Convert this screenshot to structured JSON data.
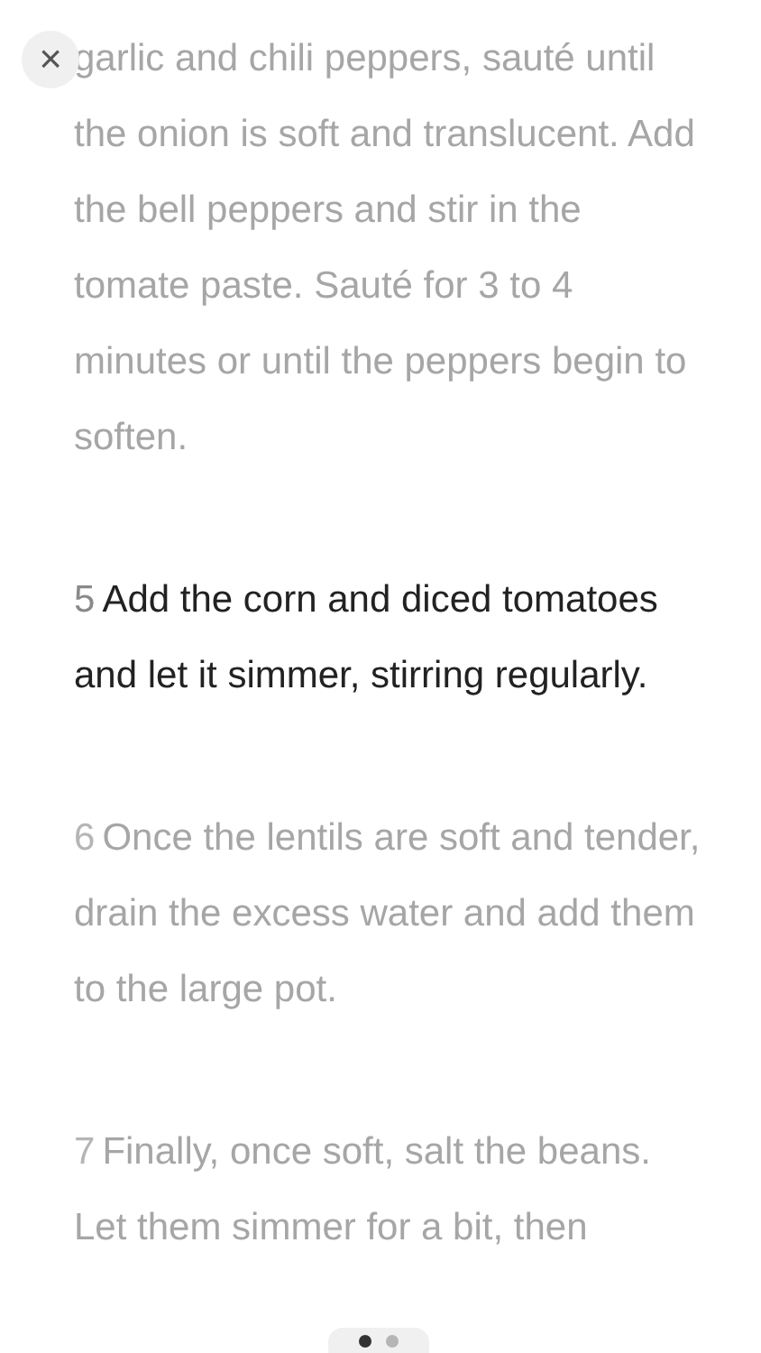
{
  "close_button": {
    "label": "×"
  },
  "steps": [
    {
      "text": "garlic and chili peppers, sauté until the onion is soft and translucent. Add the bell peppers and stir in the tomate paste. Sauté for 3 to 4 minutes or until the peppers begin to soften.",
      "selected": false
    },
    {
      "number": "5",
      "text": "Add the corn and diced tomatoes and let it simmer, stirring regularly.",
      "selected": true
    },
    {
      "number": "6",
      "text": "Once the lentils are soft and tender, drain the excess water and add them to the large pot.",
      "selected": false
    },
    {
      "number": "7",
      "text": "Finally, once soft, salt the beans. Let them simmer for a bit, then",
      "selected": false
    }
  ],
  "page_dots": [
    {
      "selected": true
    },
    {
      "selected": false
    }
  ]
}
